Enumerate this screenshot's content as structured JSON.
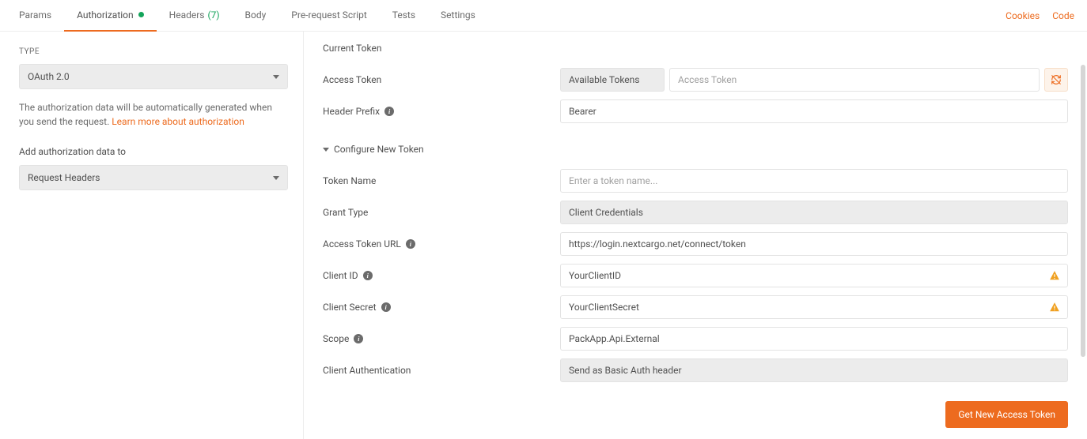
{
  "tabs": {
    "params": "Params",
    "authorization": "Authorization",
    "headers": "Headers",
    "headers_count": "(7)",
    "body": "Body",
    "prerequest": "Pre-request Script",
    "tests": "Tests",
    "settings": "Settings"
  },
  "links": {
    "cookies": "Cookies",
    "code": "Code"
  },
  "sidebar": {
    "type_label": "TYPE",
    "type_value": "OAuth 2.0",
    "desc_prefix": "The authorization data will be automatically generated when you send the request. ",
    "desc_link": "Learn more about authorization",
    "add_to_label": "Add authorization data to",
    "add_to_value": "Request Headers"
  },
  "main": {
    "current_token": "Current Token",
    "access_token_label": "Access Token",
    "available_tokens": "Available Tokens",
    "access_token_placeholder": "Access Token",
    "header_prefix_label": "Header Prefix",
    "header_prefix_value": "Bearer",
    "configure": "Configure New Token",
    "token_name_label": "Token Name",
    "token_name_placeholder": "Enter a token name...",
    "grant_type_label": "Grant Type",
    "grant_type_value": "Client Credentials",
    "access_token_url_label": "Access Token URL",
    "access_token_url_value": "https://login.nextcargo.net/connect/token",
    "client_id_label": "Client ID",
    "client_id_value": "YourClientID",
    "client_secret_label": "Client Secret",
    "client_secret_value": "YourClientSecret",
    "scope_label": "Scope",
    "scope_value": "PackApp.Api.External",
    "client_auth_label": "Client Authentication",
    "client_auth_value": "Send as Basic Auth header",
    "get_token_btn": "Get New Access Token"
  }
}
